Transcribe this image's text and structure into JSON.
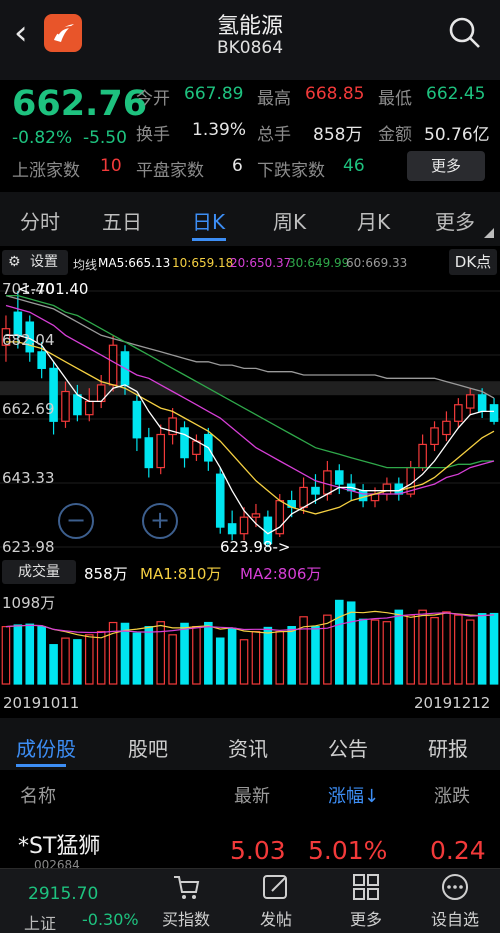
{
  "header": {
    "title": "氢能源",
    "code": "BK0864"
  },
  "quote": {
    "price": "662.76",
    "change_pct": "-0.82%",
    "change": "-5.50",
    "fields": [
      {
        "label": "今开",
        "value": "667.89",
        "tone": "green"
      },
      {
        "label": "最高",
        "value": "668.85",
        "tone": "red"
      },
      {
        "label": "最低",
        "value": "662.45",
        "tone": "green"
      },
      {
        "label": "换手",
        "value": "1.39%",
        "tone": "white"
      },
      {
        "label": "总手",
        "value": "858万",
        "tone": "white"
      },
      {
        "label": "金额",
        "value": "50.76亿",
        "tone": "white"
      }
    ],
    "up_label": "上涨家数",
    "up_value": "10",
    "flat_label": "平盘家数",
    "flat_value": "6",
    "down_label": "下跌家数",
    "down_value": "46",
    "more_label": "更多"
  },
  "period_tabs": [
    "分时",
    "五日",
    "日K",
    "周K",
    "月K",
    "更多"
  ],
  "ma_bar": {
    "settings_label": "设置",
    "label": "均线",
    "ma5": "MA5:665.13",
    "ma10": "10:659.18",
    "ma20": "20:650.37",
    "ma30": "30:649.99",
    "ma60": "60:669.33",
    "dk_label": "DK点"
  },
  "kline": {
    "y_labels": [
      "701.40",
      "682.04",
      "662.69",
      "643.33",
      "623.98"
    ],
    "high_annotation": "<-701.40",
    "low_annotation": "623.98->",
    "zoom_out": "−",
    "zoom_in": "+",
    "colors": {
      "up": "#f23a3a",
      "down": "#00e5f0",
      "ma5": "#ffffff",
      "ma10": "#f5d042",
      "ma20": "#d63fd6",
      "ma30": "#2fa84a",
      "ma60": "#9a9a9a"
    }
  },
  "volume": {
    "button_label": "成交量",
    "vol": "858万",
    "ma1": "MA1:810万",
    "ma2": "MA2:806万",
    "y_label": "1098万",
    "start_date": "20191011",
    "end_date": "20191212"
  },
  "chart_data": {
    "type": "candlestick",
    "ylim": [
      623.98,
      701.4
    ],
    "candles": [
      {
        "o": 685,
        "c": 690,
        "h": 694,
        "l": 680,
        "up": true
      },
      {
        "o": 695,
        "c": 688,
        "h": 701.4,
        "l": 684,
        "up": false
      },
      {
        "o": 692,
        "c": 683,
        "h": 694,
        "l": 680,
        "up": false
      },
      {
        "o": 683,
        "c": 678,
        "h": 686,
        "l": 675,
        "up": false
      },
      {
        "o": 678,
        "c": 662,
        "h": 680,
        "l": 658,
        "up": false
      },
      {
        "o": 662,
        "c": 671,
        "h": 674,
        "l": 660,
        "up": true
      },
      {
        "o": 670,
        "c": 664,
        "h": 673,
        "l": 662,
        "up": false
      },
      {
        "o": 664,
        "c": 668,
        "h": 672,
        "l": 662,
        "up": true
      },
      {
        "o": 668,
        "c": 673,
        "h": 676,
        "l": 666,
        "up": true
      },
      {
        "o": 673,
        "c": 685,
        "h": 688,
        "l": 671,
        "up": true
      },
      {
        "o": 683,
        "c": 673,
        "h": 685,
        "l": 670,
        "up": false
      },
      {
        "o": 668,
        "c": 657,
        "h": 670,
        "l": 653,
        "up": false
      },
      {
        "o": 657,
        "c": 648,
        "h": 660,
        "l": 645,
        "up": false
      },
      {
        "o": 648,
        "c": 658,
        "h": 661,
        "l": 646,
        "up": true
      },
      {
        "o": 658,
        "c": 663,
        "h": 666,
        "l": 655,
        "up": true
      },
      {
        "o": 660,
        "c": 651,
        "h": 662,
        "l": 648,
        "up": false
      },
      {
        "o": 652,
        "c": 656,
        "h": 658,
        "l": 650,
        "up": true
      },
      {
        "o": 658,
        "c": 650,
        "h": 660,
        "l": 647,
        "up": false
      },
      {
        "o": 646,
        "c": 630,
        "h": 648,
        "l": 628,
        "up": false
      },
      {
        "o": 631,
        "c": 628,
        "h": 635,
        "l": 626,
        "up": false
      },
      {
        "o": 628,
        "c": 633,
        "h": 636,
        "l": 626,
        "up": true
      },
      {
        "o": 633,
        "c": 634,
        "h": 637,
        "l": 630,
        "up": true
      },
      {
        "o": 633,
        "c": 625,
        "h": 635,
        "l": 623.98,
        "up": false
      },
      {
        "o": 628,
        "c": 638,
        "h": 640,
        "l": 627,
        "up": true
      },
      {
        "o": 638,
        "c": 636,
        "h": 641,
        "l": 633,
        "up": false
      },
      {
        "o": 636,
        "c": 642,
        "h": 645,
        "l": 634,
        "up": true
      },
      {
        "o": 642,
        "c": 640,
        "h": 646,
        "l": 637,
        "up": false
      },
      {
        "o": 640,
        "c": 647,
        "h": 650,
        "l": 638,
        "up": true
      },
      {
        "o": 647,
        "c": 643,
        "h": 649,
        "l": 640,
        "up": false
      },
      {
        "o": 643,
        "c": 641,
        "h": 646,
        "l": 638,
        "up": false
      },
      {
        "o": 641,
        "c": 638,
        "h": 643,
        "l": 636,
        "up": false
      },
      {
        "o": 638,
        "c": 640,
        "h": 642,
        "l": 636,
        "up": true
      },
      {
        "o": 640,
        "c": 643,
        "h": 645,
        "l": 638,
        "up": true
      },
      {
        "o": 643,
        "c": 640,
        "h": 645,
        "l": 638,
        "up": false
      },
      {
        "o": 640,
        "c": 648,
        "h": 650,
        "l": 639,
        "up": true
      },
      {
        "o": 648,
        "c": 655,
        "h": 658,
        "l": 647,
        "up": true
      },
      {
        "o": 655,
        "c": 660,
        "h": 662,
        "l": 653,
        "up": true
      },
      {
        "o": 658,
        "c": 662,
        "h": 665,
        "l": 656,
        "up": true
      },
      {
        "o": 662,
        "c": 667,
        "h": 669,
        "l": 660,
        "up": true
      },
      {
        "o": 666,
        "c": 670,
        "h": 672,
        "l": 664,
        "up": true
      },
      {
        "o": 670,
        "c": 665,
        "h": 672,
        "l": 663,
        "up": false
      },
      {
        "o": 667,
        "c": 662,
        "h": 669,
        "l": 661,
        "up": false
      }
    ],
    "ma5": [
      688,
      688,
      687,
      685,
      680,
      675,
      670,
      668,
      668,
      672,
      673,
      671,
      665,
      660,
      659,
      658,
      656,
      654,
      648,
      641,
      635,
      631,
      628,
      630,
      634,
      636,
      638,
      640,
      642,
      642,
      641,
      641,
      641,
      641,
      643,
      646,
      650,
      655,
      660,
      664,
      665,
      665
    ],
    "ma10": [
      686,
      686,
      685,
      684,
      682,
      680,
      678,
      676,
      674,
      673,
      672,
      670,
      668,
      666,
      665,
      663,
      661,
      659,
      656,
      652,
      648,
      644,
      641,
      638,
      636,
      635,
      634,
      635,
      636,
      638,
      639,
      640,
      641,
      641,
      642,
      643,
      645,
      648,
      651,
      654,
      657,
      659
    ],
    "ma20": [
      697,
      696,
      695,
      693,
      691,
      688,
      686,
      684,
      682,
      680,
      678,
      676,
      675,
      673,
      671,
      669,
      667,
      665,
      663,
      660,
      657,
      654,
      652,
      650,
      648,
      646,
      644,
      643,
      642,
      641,
      640,
      640,
      640,
      640,
      641,
      642,
      643,
      645,
      646,
      648,
      649,
      650
    ],
    "ma30": [
      700,
      700,
      699,
      698,
      697,
      695,
      694,
      692,
      690,
      688,
      686,
      684,
      682,
      680,
      678,
      676,
      674,
      672,
      670,
      668,
      666,
      664,
      662,
      660,
      658,
      656,
      654,
      653,
      652,
      651,
      650,
      649,
      648,
      648,
      648,
      648,
      648,
      648,
      649,
      649,
      650,
      650
    ],
    "ma60": [
      700,
      699,
      698,
      697,
      696,
      694,
      692,
      690,
      688,
      687,
      686,
      685,
      684,
      683,
      682,
      681,
      680,
      680,
      679,
      679,
      678,
      678,
      677,
      677,
      677,
      676,
      676,
      676,
      676,
      676,
      676,
      676,
      675,
      675,
      675,
      675,
      675,
      674,
      673,
      672,
      671,
      669
    ],
    "volume": [
      700,
      720,
      730,
      700,
      480,
      560,
      540,
      600,
      640,
      750,
      740,
      620,
      700,
      760,
      600,
      740,
      700,
      750,
      560,
      680,
      540,
      640,
      690,
      640,
      700,
      820,
      700,
      840,
      1020,
      1000,
      790,
      780,
      760,
      900,
      840,
      900,
      810,
      880,
      840,
      780,
      858,
      860
    ]
  },
  "bottom_tabs": [
    "成份股",
    "股吧",
    "资讯",
    "公告",
    "研报"
  ],
  "table": {
    "headers": [
      "名称",
      "最新",
      "涨幅↓",
      "涨跌"
    ],
    "row": {
      "name": "*ST猛狮",
      "code": "002684",
      "last": "5.03",
      "pct": "5.01%",
      "chg": "0.24"
    }
  },
  "footer": {
    "index_value": "2915.70",
    "index_name": "上证",
    "index_chg": "-0.30%",
    "buttons": [
      "买指数",
      "发帖",
      "更多",
      "设自选"
    ]
  }
}
